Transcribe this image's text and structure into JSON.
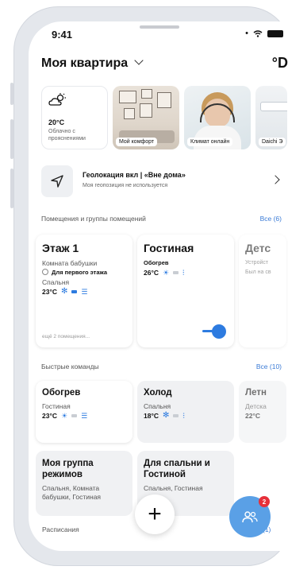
{
  "status_bar": {
    "time": "9:41"
  },
  "header": {
    "title": "Моя квартира",
    "brand": "°D"
  },
  "stories": {
    "weather": {
      "temp": "20°C",
      "desc": "Облачно с прояснениями"
    },
    "items": [
      "Мой комфорт",
      "Климат онлайн",
      "Daichi Э"
    ]
  },
  "geo": {
    "title": "Геолокация вкл | «Вне дома»",
    "subtitle": "Моя геопозиция не используется"
  },
  "rooms_section": {
    "title": "Помещения и группы помещений",
    "all": "Все (6)",
    "cards": [
      {
        "name": "Этаж 1",
        "line1": "Комната бабушки",
        "schedule": "Для первого этажа",
        "line2": "Спальня",
        "temp": "23°C",
        "more": "ещё 2 помещения..."
      },
      {
        "name": "Гостиная",
        "mode": "Обогрев",
        "temp": "26°C"
      },
      {
        "name": "Детс",
        "line1": "Устройст",
        "line2": "Был на св"
      }
    ]
  },
  "commands_section": {
    "title": "Быстрые команды",
    "all": "Все (10)",
    "cards": [
      {
        "name": "Обогрев",
        "room": "Гостиная",
        "temp": "23°C"
      },
      {
        "name": "Холод",
        "room": "Спальня",
        "temp": "18°C"
      },
      {
        "name": "Летн",
        "room": "Детска",
        "temp": "22°C"
      }
    ],
    "groups": [
      {
        "name": "Моя группа режимов",
        "rooms": "Спальня, Комната бабушки, Гостиная"
      },
      {
        "name": "Для спальни и Гостиной",
        "rooms": "Спальня, Гостиная"
      }
    ]
  },
  "schedules": {
    "title": "Расписания",
    "count": "(1)"
  },
  "fab": {
    "add": "+",
    "badge": "2"
  },
  "colors": {
    "accent": "#2d7be0",
    "badge": "#e6303a",
    "fab_users": "#5aa0e6"
  }
}
